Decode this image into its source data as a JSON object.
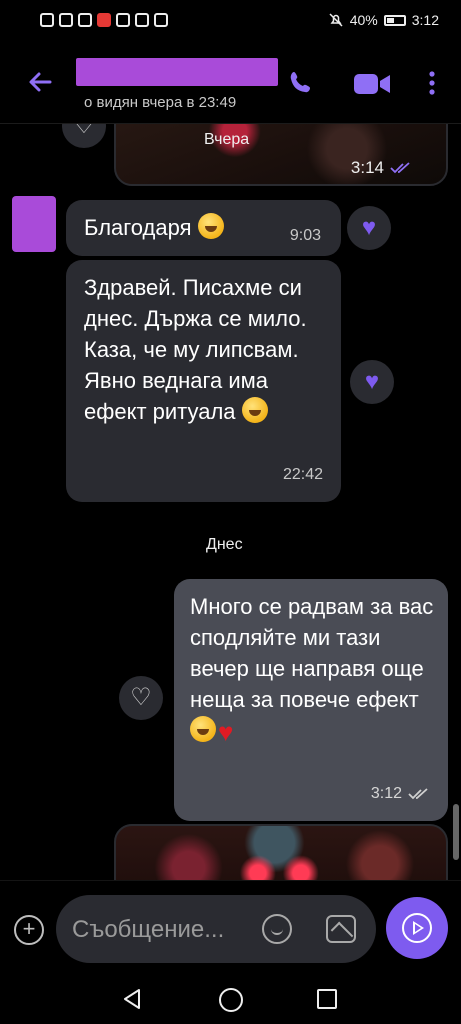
{
  "status_bar": {
    "battery_percent": "40%",
    "time": "3:12"
  },
  "header": {
    "contact_name": "",
    "last_seen": "о видян вчера в 23:49"
  },
  "chat": {
    "top_photo": {
      "time": "3:14",
      "status_icon": "double-check-icon"
    },
    "date_yesterday": "Вчера",
    "messages": [
      {
        "direction": "incoming",
        "text": "Благодаря",
        "emoji": "smiling-face-with-hearts",
        "time": "9:03",
        "reaction": "heart-filled"
      },
      {
        "direction": "incoming",
        "text": "Здравей. Писахме си днес. Държа се мило. Каза, че му липсвам. Явно веднага има ефект ритуала",
        "emoji": "smiling-face-with-hearts",
        "time": "22:42",
        "reaction": "heart-filled"
      },
      {
        "direction": "outgoing",
        "text": "Много се радвам за вас сподляйте ми тази вечер ще направя още неща за повече ефект",
        "emoji": "hugging-face red-heart",
        "time": "3:12",
        "status_icon": "double-check-icon",
        "reaction": "heart-outline"
      }
    ],
    "date_today": "Днес"
  },
  "input": {
    "placeholder": "Съобщение..."
  },
  "colors": {
    "accent": "#7e5bef",
    "incoming_bubble": "#2a2b31",
    "outgoing_bubble": "#4a4c55",
    "background": "#000000"
  }
}
